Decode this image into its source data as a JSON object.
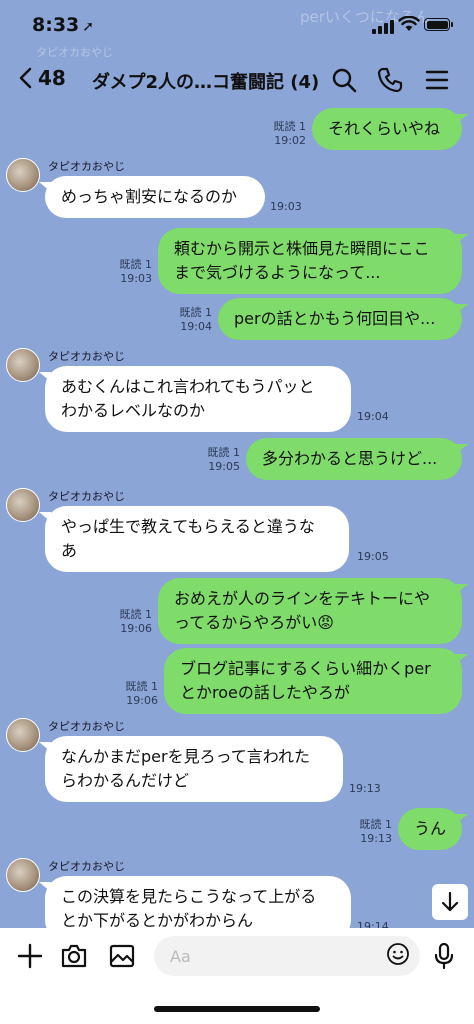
{
  "status": {
    "time": "8:33",
    "preview": "perいくつになるん"
  },
  "ghost_sender": "タピオカおやじ",
  "header": {
    "back_count": "48",
    "title": "ダメプ2人の…コ奮闘記 (4)"
  },
  "messages": [
    {
      "dir": "out",
      "text": [
        "それくらいやね"
      ],
      "read": "既読 1",
      "time": "19:02"
    },
    {
      "dir": "in",
      "sender": "タピオカおやじ",
      "text": [
        "めっちゃ割安になるのか"
      ],
      "time": "19:03"
    },
    {
      "dir": "out",
      "text": [
        "頼むから開示と株価見た瞬間にここ",
        "まで気づけるようになって..."
      ],
      "read": "既読 1",
      "time": "19:03"
    },
    {
      "dir": "out",
      "text": [
        "perの話とかもう何回目や..."
      ],
      "read": "既読 1",
      "time": "19:04"
    },
    {
      "dir": "in",
      "sender": "タピオカおやじ",
      "text": [
        "あむくんはこれ言われてもうパッと",
        "わかるレベルなのか"
      ],
      "time": "19:04"
    },
    {
      "dir": "out",
      "text": [
        "多分わかると思うけど..."
      ],
      "read": "既読 1",
      "time": "19:05"
    },
    {
      "dir": "in",
      "sender": "タピオカおやじ",
      "text": [
        "やっぱ生で教えてもらえると違うな",
        "あ"
      ],
      "time": "19:05"
    },
    {
      "dir": "out",
      "text": [
        "おめえが人のラインをテキトーにや",
        "ってるからやろがい😡"
      ],
      "read": "既読 1",
      "time": "19:06"
    },
    {
      "dir": "out",
      "text": [
        "ブログ記事にするくらい細かくper",
        "とかroeの話したやろが"
      ],
      "read": "既読 1",
      "time": "19:06"
    },
    {
      "dir": "in",
      "sender": "タピオカおやじ",
      "text": [
        "なんかまだperを見ろって言われた",
        "らわかるんだけど"
      ],
      "time": "19:13"
    },
    {
      "dir": "out",
      "text": [
        "うん"
      ],
      "read": "既読 1",
      "time": "19:13"
    },
    {
      "dir": "in",
      "sender": "タピオカおやじ",
      "text": [
        "この決算を見たらこうなって上がる",
        "とか下がるとかがわからん"
      ],
      "time": "19:14"
    }
  ],
  "input": {
    "placeholder": "Aa"
  },
  "icons": {
    "back": "chevron-left-icon",
    "search": "search-icon",
    "call": "phone-icon",
    "menu": "menu-icon",
    "plus": "plus-icon",
    "camera": "camera-icon",
    "image": "image-icon",
    "emoji": "emoji-icon",
    "mic": "microphone-icon",
    "scroll": "arrow-down-icon"
  },
  "colors": {
    "background": "#8BA5D6",
    "outgoing": "#7FDB6A",
    "incoming": "#FFFFFF"
  }
}
